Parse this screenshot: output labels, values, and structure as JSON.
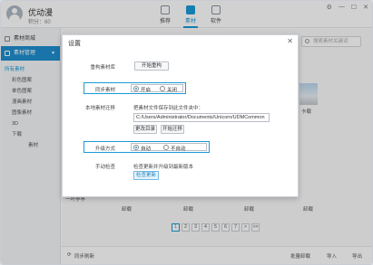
{
  "header": {
    "username": "优动漫",
    "points": "积分：60",
    "nav": [
      {
        "label": "推荐",
        "icon": "recommend-icon"
      },
      {
        "label": "素材",
        "icon": "material-icon"
      },
      {
        "label": "软件",
        "icon": "software-icon"
      }
    ],
    "window_controls": [
      "⚙",
      "—",
      "☐",
      "✕"
    ]
  },
  "sidebar": {
    "items": [
      {
        "label": "素材商城",
        "icon": "store-icon"
      },
      {
        "label": "素材管理",
        "icon": "manage-icon"
      }
    ],
    "tree_title": "所有素材",
    "tree": [
      "彩色图案",
      "单色图案",
      "漫画素材",
      "图像素材",
      "3D",
      "下载"
    ],
    "tree_sub": "素材"
  },
  "main": {
    "search_placeholder": "搜索素材关键词",
    "pager": [
      "1",
      "2",
      "3",
      "4",
      "5",
      "6",
      "7",
      ">",
      ">>"
    ],
    "download_label": "卸载",
    "edge_left": "一叶亭亭",
    "edge_right": "卡载",
    "footer": {
      "sync_refresh": "同步刷新",
      "batch_uninstall": "批量卸载",
      "import": "导入",
      "export": "导出"
    }
  },
  "modal": {
    "title": "设置",
    "close": "✕",
    "rebuild": {
      "label": "重构素材库",
      "button": "开始重构"
    },
    "sync": {
      "label": "同步素材",
      "on": "开启",
      "off": "关闭"
    },
    "migrate": {
      "label": "本地素材迁移",
      "hint": "把素材文件保存到此文件夹中：",
      "path": "C:/Users/Administrator/Documents/Unicorn/UDMCommon",
      "change_button": "更改目录",
      "start_button": "开始迁移"
    },
    "upgrade": {
      "label": "升级方式",
      "auto": "自动",
      "manual": "不自动"
    },
    "check": {
      "label": "手动检查",
      "hint": "检查更新并升级到最新版本",
      "button": "检查更新"
    }
  }
}
